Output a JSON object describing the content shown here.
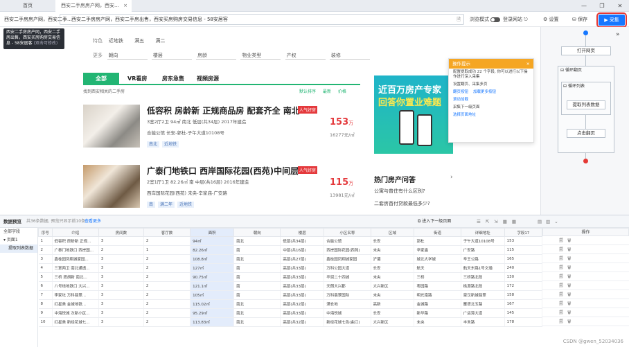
{
  "tabs": {
    "home": "首页",
    "active": "西安二手房房产网，西安...",
    "close": "×"
  },
  "window": {
    "min": "—",
    "max": "❐",
    "close": "✕"
  },
  "toolbar": {
    "title": "西安二手房房产网，西安二手...",
    "url": "西安二手房房产网，西安二手房出售，西安买房购房交易信息 - 58安居客",
    "browse_mode": "浏览模式",
    "login": "登录网站",
    "settings": "设置",
    "save": "保存",
    "collect": "采集"
  },
  "tooltip": {
    "text": "西安二手房房产网，西安二手房出售，西安买房购房交易信息 - 58安居客",
    "tip": "(双击可修改)"
  },
  "filters": {
    "row1_label": "特色",
    "row1_opts": [
      "近地铁",
      "满五",
      "满二"
    ],
    "row2_label": "更多",
    "row2_sels": [
      "朝向",
      "楼层",
      "房龄",
      "物业类型",
      "产权",
      "装修"
    ]
  },
  "page_tabs": [
    "全部",
    "VR看房",
    "房东急售",
    "视频房源"
  ],
  "found": "找到西安相关的二手房",
  "sort": [
    "默认排序",
    "最新",
    "价格"
  ],
  "listings": [
    {
      "title": "低容积 房龄新 正规商品房 配套齐全 南北...",
      "hot": "人气好房",
      "info": "3室2厅2卫   94㎡   南北   低层(共34层)   2017年建造",
      "info2": "合能公馆   长安-郭杜-子午大道10108号",
      "tags": [
        "南北",
        "近地铁"
      ],
      "price": "153",
      "unit_label": "万",
      "unit_price": "16277元/㎡"
    },
    {
      "title": "广泰门地铁口 西岸国际花园(西苑)中间层 ...",
      "hot": "人气好房",
      "info": "2室1厅1卫   82.26㎡   南   中层(共16层)   2016年建造",
      "info2": "西岸国际花园(西苑)   未央-辛家庙-广安路",
      "tags": [
        "南",
        "满二年",
        "近地铁"
      ],
      "price": "115",
      "unit_label": "万",
      "unit_price": "13981元/㎡"
    }
  ],
  "ad": {
    "line1": "近百万房产专家",
    "line2": "回答你置业难题"
  },
  "qa": {
    "title": "热门房产问答",
    "arrow": "›",
    "items": [
      "公寓与普住有什么区别?",
      "二套房首付贷款最低多少?"
    ]
  },
  "popup": {
    "title": "操作提示",
    "close": "×",
    "lines": [
      "配置提取成功 22 个字段, 你可以进行以下操作进行深入采集",
      "设置翻页、采集多页",
      "翻页按钮",
      "加载更多按钮",
      "滚动加载",
      "采集下一级页面",
      "选择页面地址"
    ]
  },
  "flow": {
    "nodes": [
      "打开网页",
      "提取列表数据",
      "点击翻页"
    ],
    "boxes": [
      "循环翻页",
      "循环列表"
    ],
    "collapse": "»"
  },
  "data_panel": {
    "title": "数据预览",
    "count": "共36条数据, 预览只显示前10条",
    "more": "查看更多",
    "enter_next": "进入下一级页面",
    "left_items": [
      "全部字段",
      "页面1",
      "提取列表数据"
    ],
    "ops_header": "操作",
    "ops_icons": "🗐🗑",
    "columns": [
      "序号",
      "介绍",
      "房间数",
      "客厅数",
      "面积",
      "朝向",
      "楼层",
      "小区名称",
      "区域",
      "街道",
      "详细地址",
      "字段17"
    ],
    "rows": [
      [
        "1",
        "低容积 房龄新 正规...",
        "3",
        "2",
        "94㎡",
        "南北",
        "低层(共34层)",
        "合能公馆",
        "长安",
        "郭杜",
        "子午大道10108号",
        "153"
      ],
      [
        "2",
        "广泰门地铁口 西岸国...",
        "2",
        "1",
        "82.26㎡",
        "南",
        "中层(共16层)",
        "西岸国际花园(西苑)",
        "未央",
        "辛家庙",
        "广安路",
        "115"
      ],
      [
        "3",
        "鑫桂园凤翔城家园...",
        "3",
        "2",
        "108.8㎡",
        "南北",
        "高层(共27层)",
        "鑫桂园凤翔城家园",
        "浐灞",
        "城北大学城",
        "辛王公路",
        "165"
      ],
      [
        "4",
        "三室两卫 南北通透...",
        "3",
        "2",
        "127㎡",
        "南",
        "高层(共33层)",
        "万科公园大道",
        "长安",
        "航天",
        "航天东路1号文瀚",
        "240"
      ],
      [
        "5",
        "三桥 塔胡新 南北...",
        "3",
        "2",
        "90.75㎡",
        "南",
        "高层(共33层)",
        "华润二十四城",
        "未央",
        "三桥",
        "三桥路北段",
        "130"
      ],
      [
        "6",
        "八号线地铁口 大兴...",
        "3",
        "2",
        "121.1㎡",
        "南",
        "高层(共33层)",
        "天朗大兴郡",
        "大兴新区",
        "枣园路",
        "桃源路北段",
        "172"
      ],
      [
        "7",
        "李家圪 万科翡翠...",
        "3",
        "2",
        "105㎡",
        "南",
        "高层(共33层)",
        "万科翡翠国际",
        "未央",
        "明光南路",
        "豪汉新城翡翠",
        "158"
      ],
      [
        "8",
        "红星美 金城地铁...",
        "3",
        "2",
        "115.02㎡",
        "南北",
        "高层(共32层)",
        "满仓地",
        "高新",
        "金城路",
        "雁塔北五路",
        "167"
      ],
      [
        "9",
        "中海悦城 次新小区...",
        "3",
        "2",
        "95.29㎡",
        "南北",
        "高层(共33层)",
        "中海悦城",
        "长安",
        "新华路",
        "广运潭大道",
        "145"
      ],
      [
        "10",
        "红星美 新经花城七...",
        "3",
        "2",
        "113.83㎡",
        "南北",
        "高层(共32层)",
        "新经花城七色(曲江)",
        "大兴新区",
        "未央",
        "丰禾路",
        "178"
      ]
    ]
  },
  "watermark": "CSDN @gwen_52034036"
}
